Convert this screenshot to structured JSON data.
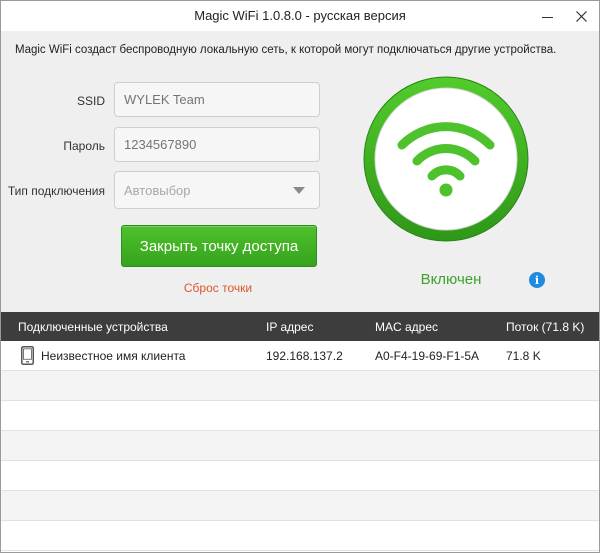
{
  "window": {
    "title": "Magic WiFi  1.0.8.0 - русская версия"
  },
  "description": "Magic WiFi создаст беспроводную локальную сеть, к которой могут подключаться другие устройства.",
  "form": {
    "ssid_label": "SSID",
    "ssid_placeholder": "WYLEK Team",
    "password_label": "Пароль",
    "password_placeholder": "1234567890",
    "connection_type_label": "Тип подключения",
    "connection_type_value": "Автовыбор"
  },
  "actions": {
    "close_hotspot_label": "Закрыть точку доступа",
    "reset_label": "Сброс точки"
  },
  "status": {
    "text": "Включен",
    "wifi_icon": "wifi-icon",
    "info_icon": "info-icon"
  },
  "table": {
    "headers": {
      "device": "Подключенные устройства",
      "ip": "IP адрес",
      "mac": "MAC адрес",
      "traffic": "Поток (71.8 K)"
    },
    "rows": [
      {
        "device": "Неизвестное имя клиента",
        "ip": "192.168.137.2",
        "mac": "A0-F4-19-69-F1-5A",
        "traffic": "71.8 K",
        "icon": "phone-icon"
      }
    ]
  },
  "colors": {
    "accent_green": "#3aa52a",
    "reset_link": "#e0552c",
    "info_blue": "#1f8be0",
    "table_header": "#3d3d3d"
  }
}
